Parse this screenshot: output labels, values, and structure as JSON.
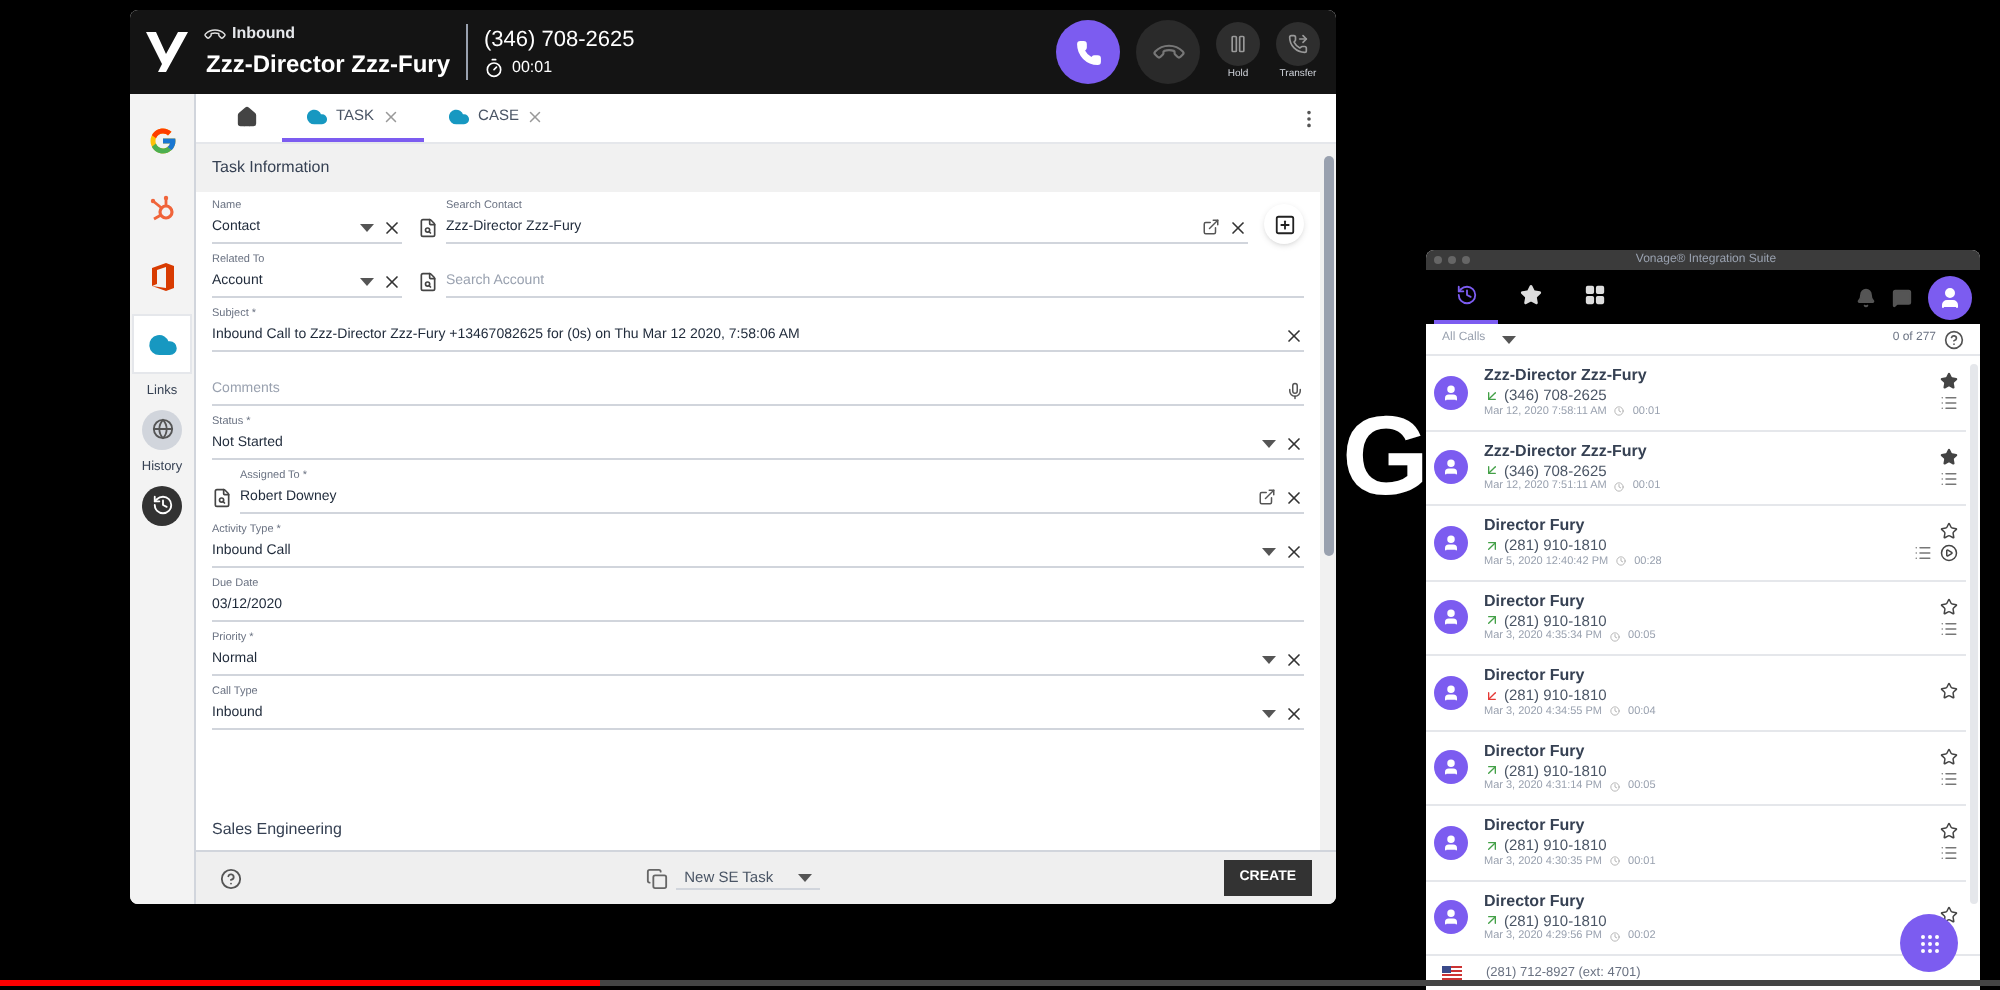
{
  "backdrop": {
    "heading": "G"
  },
  "crm_window": {
    "header": {
      "direction": "Inbound",
      "caller": "Zzz-Director Zzz-Fury",
      "number": "(346) 708-2625",
      "timer": "00:01",
      "buttons": [
        {
          "kind": "answer"
        },
        {
          "kind": "hangup"
        },
        {
          "kind": "hold",
          "label": "Hold"
        },
        {
          "kind": "transfer",
          "label": "Transfer"
        }
      ]
    },
    "rail": {
      "items": [
        {
          "kind": "google",
          "selected": false
        },
        {
          "kind": "hubspot",
          "selected": false
        },
        {
          "kind": "office",
          "selected": false
        },
        {
          "kind": "salesforce",
          "selected": true
        }
      ],
      "links_label": "Links",
      "history_label": "History"
    },
    "tabs": [
      {
        "kind": "home",
        "selected": false
      },
      {
        "kind": "record",
        "label": "TASK",
        "selected": true
      },
      {
        "kind": "record",
        "label": "CASE",
        "selected": false
      }
    ],
    "section_title": "Task Information",
    "rows": [
      [
        {
          "kind": "select",
          "label": "Name",
          "value": "Contact"
        },
        {
          "kind": "lookup",
          "label": "Search Contact",
          "value": "Zzz-Director Zzz-Fury"
        }
      ],
      [
        {
          "kind": "select",
          "label": "Related To",
          "value": "Account"
        },
        {
          "kind": "lookup",
          "placeholder": "Search Account"
        }
      ],
      [
        {
          "kind": "text",
          "label": "Subject *",
          "value": "Inbound Call to Zzz-Director Zzz-Fury +13467082625 for (0s) on Thu Mar 12 2020, 7:58:06 AM"
        }
      ],
      [
        {
          "kind": "textarea",
          "placeholder": "Comments"
        }
      ],
      [
        {
          "kind": "select",
          "label": "Status *",
          "value": "Not Started"
        }
      ],
      [
        {
          "kind": "lookup",
          "label": "Assigned To *",
          "value": "Robert Downey"
        }
      ],
      [
        {
          "kind": "select",
          "label": "Activity Type *",
          "value": "Inbound Call"
        }
      ],
      [
        {
          "kind": "date",
          "label": "Due Date",
          "value": "03/12/2020"
        }
      ],
      [
        {
          "kind": "select",
          "label": "Priority *",
          "value": "Normal"
        }
      ],
      [
        {
          "kind": "select",
          "label": "Call Type",
          "value": "Inbound"
        }
      ]
    ],
    "next_section": "Sales Engineering",
    "footer": {
      "template": "New SE Task",
      "create": "CREATE"
    }
  },
  "calls_window": {
    "title": "Vonage® Integration Suite",
    "tabs": [
      {
        "kind": "history",
        "selected": true
      },
      {
        "kind": "favorites",
        "selected": false
      },
      {
        "kind": "apps",
        "selected": false
      }
    ],
    "filter": "All Calls",
    "count": "0 of 277",
    "calls": [
      {
        "name": "Zzz-Director Zzz-Fury",
        "kind": "inbound",
        "number": "(346) 708-2625",
        "date": "Mar 12, 2020 7:58:11 AM",
        "duration": "00:01",
        "favorite": true,
        "notes": true,
        "recording": false
      },
      {
        "name": "Zzz-Director Zzz-Fury",
        "kind": "inbound",
        "number": "(346) 708-2625",
        "date": "Mar 12, 2020 7:51:11 AM",
        "duration": "00:01",
        "favorite": true,
        "notes": true,
        "recording": false
      },
      {
        "name": "Director Fury",
        "kind": "outbound",
        "number": "(281) 910-1810",
        "date": "Mar 5, 2020 12:40:42 PM",
        "duration": "00:28",
        "favorite": false,
        "notes": true,
        "recording": true
      },
      {
        "name": "Director Fury",
        "kind": "outbound",
        "number": "(281) 910-1810",
        "date": "Mar 3, 2020 4:35:34 PM",
        "duration": "00:05",
        "favorite": false,
        "notes": true,
        "recording": false
      },
      {
        "name": "Director Fury",
        "kind": "missed",
        "number": "(281) 910-1810",
        "date": "Mar 3, 2020 4:34:55 PM",
        "duration": "00:04",
        "favorite": false,
        "notes": false,
        "recording": false
      },
      {
        "name": "Director Fury",
        "kind": "outbound",
        "number": "(281) 910-1810",
        "date": "Mar 3, 2020 4:31:14 PM",
        "duration": "00:05",
        "favorite": false,
        "notes": true,
        "recording": false
      },
      {
        "name": "Director Fury",
        "kind": "outbound",
        "number": "(281) 910-1810",
        "date": "Mar 3, 2020 4:30:35 PM",
        "duration": "00:01",
        "favorite": false,
        "notes": true,
        "recording": false
      },
      {
        "name": "Director Fury",
        "kind": "outbound",
        "number": "(281) 910-1810",
        "date": "Mar 3, 2020 4:29:56 PM",
        "duration": "00:02",
        "favorite": false,
        "notes": false,
        "recording": false
      }
    ],
    "own_number": "(281) 712-8927 (ext: 4701)"
  },
  "video_progress": {
    "level": 0.3
  }
}
